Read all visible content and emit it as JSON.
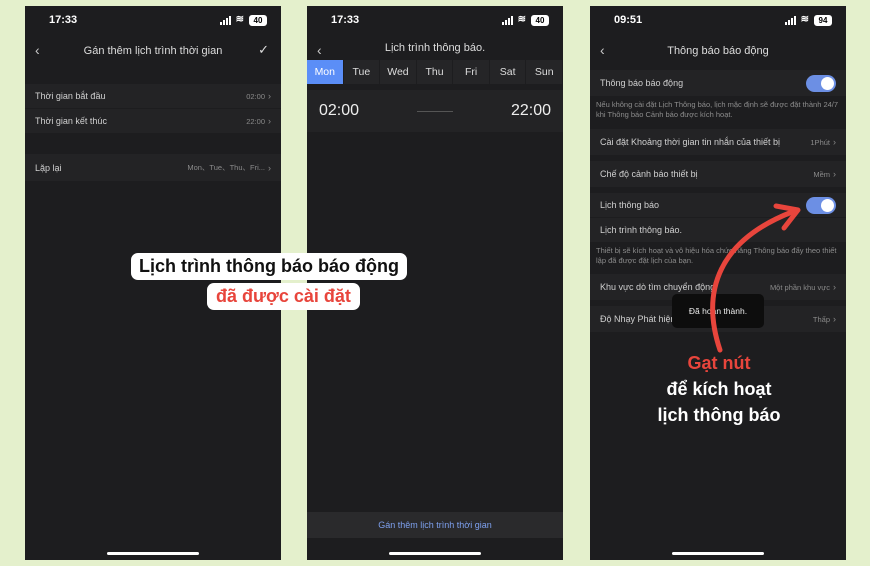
{
  "phone1": {
    "time": "17:33",
    "battery": "40",
    "title": "Gán thêm lịch trình thời  gian",
    "start_label": "Thời gian bắt đầu",
    "start_value": "02:00",
    "end_label": "Thời gian kết thúc",
    "end_value": "22:00",
    "repeat_label": "Lặp lại",
    "repeat_value": "Mon、Tue、Thu、Fri..."
  },
  "phone2": {
    "time": "17:33",
    "battery": "40",
    "title": "Lịch trình thông báo.",
    "days": [
      "Mon",
      "Tue",
      "Wed",
      "Thu",
      "Fri",
      "Sat",
      "Sun"
    ],
    "active_day": "Mon",
    "start_time": "02:00",
    "end_time": "22:00",
    "footer_button": "Gán thêm lịch trình thời  gian"
  },
  "phone3": {
    "time": "09:51",
    "battery": "94",
    "title": "Thông báo báo động",
    "alarm_label": "Thông báo báo động",
    "alarm_on": true,
    "alarm_note": "Nếu không cài đặt Lịch Thông báo, lịch mặc định sẽ được đặt thành 24/7 khi Thông báo Cảnh báo được kích hoạt.",
    "interval_label": "Cài đặt Khoảng thời gian tin nhắn của thiết bị",
    "interval_value": "1Phút",
    "mode_label": "Chế độ cảnh báo thiết bị",
    "mode_value": "Mềm",
    "schedule_label": "Lịch thông báo",
    "schedule_on": true,
    "schedule_sub": "Lịch trình thông báo.",
    "schedule_note": "Thiết bị sẽ kích hoạt và vô hiệu hóa chức năng Thông báo đẩy theo thiết lập đã được đặt lịch của bạn.",
    "zone_label": "Khu vực dò tìm chuyển động",
    "zone_value": "Một phần khu vực",
    "sensitivity_label": "Độ Nhạy Phát hiện Chuyển động",
    "sensitivity_value": "Thấp",
    "toast": "Đã hoàn thành."
  },
  "captions": {
    "c1_line1": "Lịch trình thông báo báo động",
    "c1_line2": "đã được cài đặt",
    "c2_line1": "Gạt nút",
    "c2_line2": "để kích hoạt",
    "c2_line3": "lịch thông báo"
  },
  "colors": {
    "accent": "#5b8ef7",
    "highlight": "#e8453c",
    "background": "#e4f0cc"
  }
}
